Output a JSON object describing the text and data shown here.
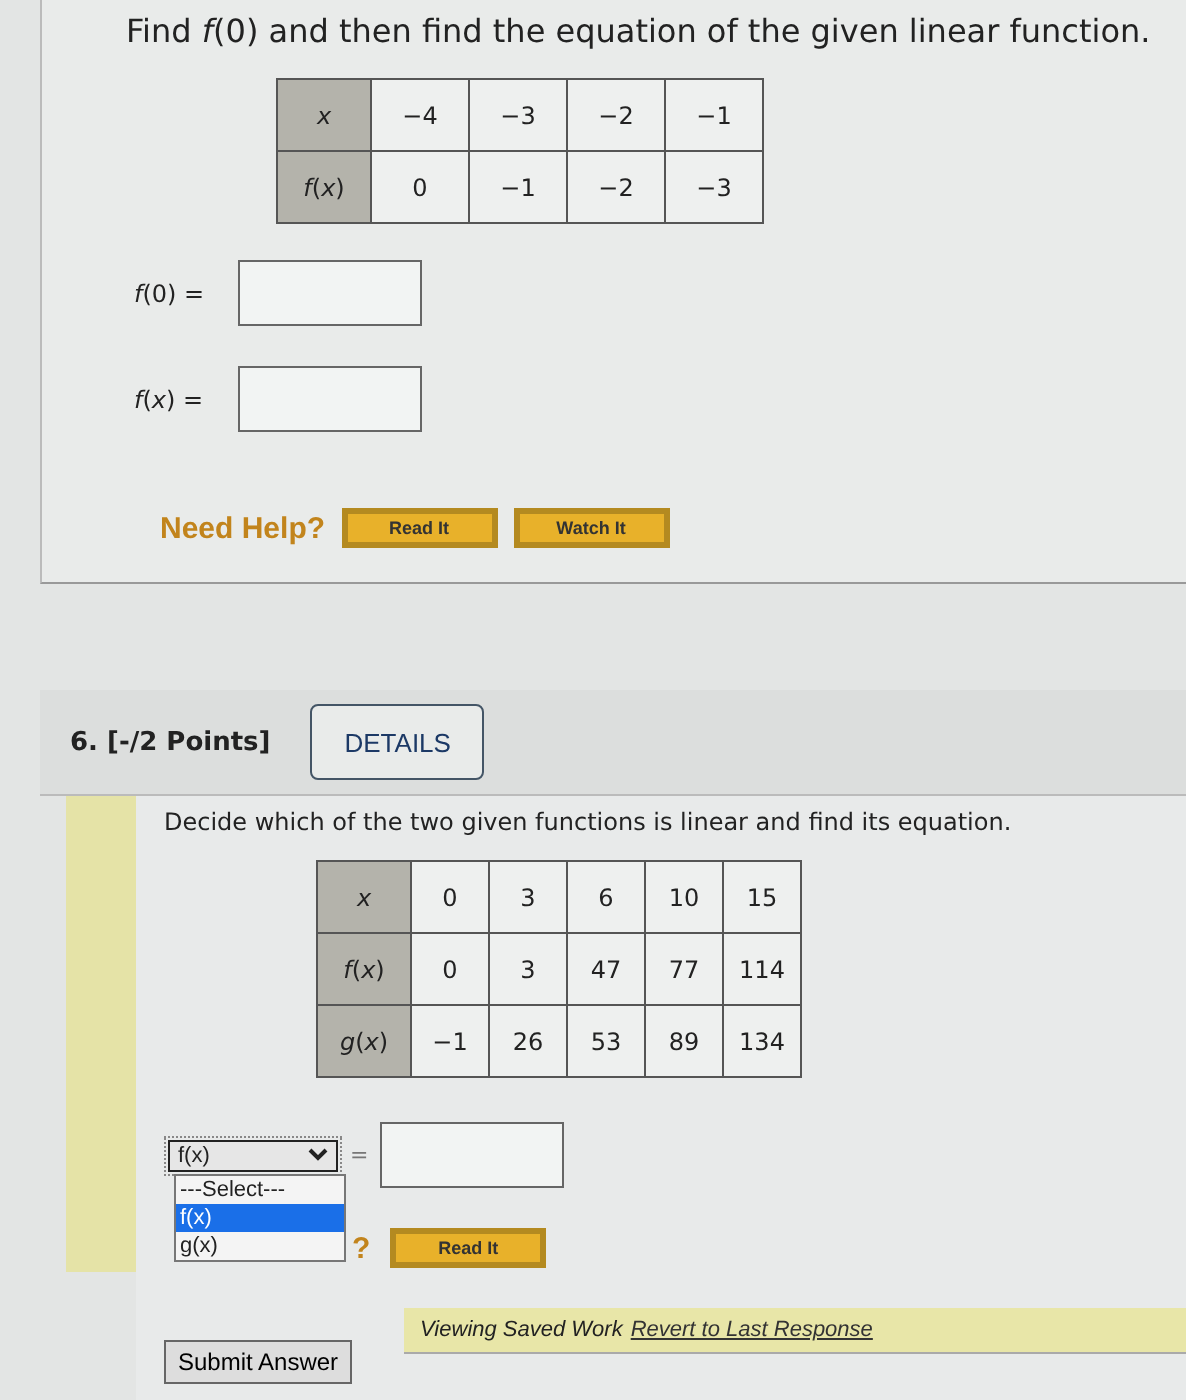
{
  "question_5": {
    "prompt": "Find *f*(0) and then find the equation of the given linear function.",
    "table": {
      "rows": [
        {
          "label": "*x*",
          "cells": [
            "−4",
            "−3",
            "−2",
            "−1"
          ]
        },
        {
          "label": "*f*(*x*)",
          "cells": [
            "0",
            "−1",
            "−2",
            "−3"
          ]
        }
      ]
    },
    "answers": [
      {
        "label": "*f*(0)  ="
      },
      {
        "label": "*f*(*x*)  ="
      }
    ],
    "help": {
      "label": "Need Help?",
      "buttons": [
        "Read It",
        "Watch It"
      ]
    }
  },
  "question_6": {
    "number": "6.  [-/2 Points]",
    "details_button": "DETAILS",
    "prompt": "Decide which of the two given functions is linear and find its equation.",
    "table": {
      "rows": [
        {
          "label": "*x*",
          "cells": [
            "0",
            "3",
            "6",
            "10",
            "15"
          ]
        },
        {
          "label": "*f*(*x*)",
          "cells": [
            "0",
            "3",
            "47",
            "77",
            "114"
          ]
        },
        {
          "label": "*g*(*x*)",
          "cells": [
            "−1",
            "26",
            "53",
            "89",
            "134"
          ]
        }
      ]
    },
    "select": {
      "value": "f(x)",
      "expanded": true,
      "options": [
        {
          "label": "---Select---",
          "selected": false
        },
        {
          "label": "f(x)",
          "selected": true
        },
        {
          "label": "g(x)",
          "selected": false
        }
      ]
    },
    "equals": "=",
    "help": {
      "label": "?",
      "buttons": [
        "Read It"
      ]
    },
    "submit_button": "Submit Answer",
    "saved_notice": {
      "text": "Viewing Saved Work",
      "link": "Revert to Last Response"
    }
  }
}
